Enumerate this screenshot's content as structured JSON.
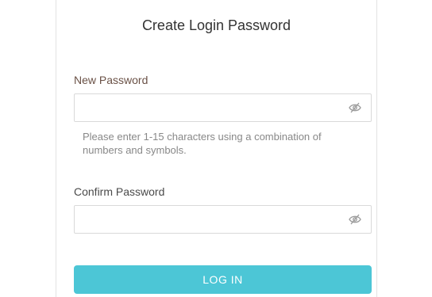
{
  "dialog": {
    "title": "Create Login Password",
    "new_password": {
      "label": "New Password",
      "value": "",
      "placeholder": "",
      "toggle_icon": "eye-slash-icon"
    },
    "hint": "Please enter 1-15 characters using a combination of numbers and symbols.",
    "confirm_password": {
      "label": "Confirm Password",
      "value": "",
      "placeholder": "",
      "toggle_icon": "eye-slash-icon"
    },
    "login_button": "LOG IN"
  },
  "colors": {
    "button": "#4cc6d6",
    "button_text": "#ffffff",
    "border": "#d9d9d9"
  }
}
